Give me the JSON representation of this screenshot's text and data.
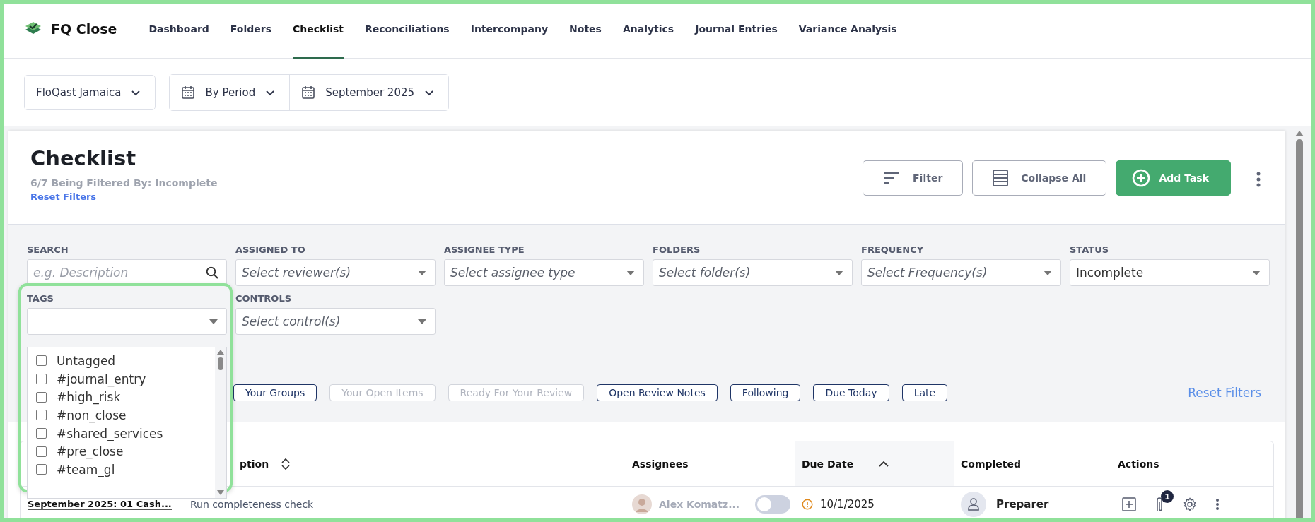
{
  "app": {
    "name": "FQ Close"
  },
  "nav": [
    {
      "label": "Dashboard",
      "selected": false
    },
    {
      "label": "Folders",
      "selected": false
    },
    {
      "label": "Checklist",
      "selected": true
    },
    {
      "label": "Reconciliations",
      "selected": false
    },
    {
      "label": "Intercompany",
      "selected": false
    },
    {
      "label": "Notes",
      "selected": false
    },
    {
      "label": "Analytics",
      "selected": false
    },
    {
      "label": "Journal Entries",
      "selected": false
    },
    {
      "label": "Variance Analysis",
      "selected": false
    }
  ],
  "toolbar": {
    "entity": "FloQast Jamaica",
    "view": "By Period",
    "period": "September 2025"
  },
  "checklist": {
    "title": "Checklist",
    "filter_summary": "6/7 Being Filtered By: Incomplete",
    "reset_link": "Reset Filters",
    "buttons": [
      {
        "kind": "filter",
        "label": "Filter"
      },
      {
        "kind": "collapse",
        "label": "Collapse All"
      },
      {
        "kind": "add",
        "label": "Add Task"
      }
    ]
  },
  "filters": [
    {
      "kind": "search",
      "label": "SEARCH",
      "placeholder": "e.g. Description"
    },
    {
      "kind": "select",
      "label": "ASSIGNED TO",
      "placeholder": "Select reviewer(s)"
    },
    {
      "kind": "select",
      "label": "ASSIGNEE TYPE",
      "placeholder": "Select assignee type"
    },
    {
      "kind": "select",
      "label": "FOLDERS",
      "placeholder": "Select folder(s)"
    },
    {
      "kind": "select",
      "label": "FREQUENCY",
      "placeholder": "Select Frequency(s)"
    },
    {
      "kind": "select",
      "label": "STATUS",
      "value": "Incomplete"
    },
    {
      "kind": "tags",
      "label": "TAGS"
    },
    {
      "kind": "select",
      "label": "CONTROLS",
      "placeholder": "Select control(s)"
    }
  ],
  "tag_options": [
    {
      "label": "Untagged",
      "checked": false
    },
    {
      "label": "#journal_entry",
      "checked": false
    },
    {
      "label": "#high_risk",
      "checked": false
    },
    {
      "label": "#non_close",
      "checked": false
    },
    {
      "label": "#shared_services",
      "checked": false
    },
    {
      "label": "#pre_close",
      "checked": false
    },
    {
      "label": "#team_gl",
      "checked": false
    }
  ],
  "quick_filters": [
    {
      "label": "Your Groups",
      "disabled": false
    },
    {
      "label": "Your Open Items",
      "disabled": true
    },
    {
      "label": "Ready For Your Review",
      "disabled": true
    },
    {
      "label": "Open Review Notes",
      "disabled": false
    },
    {
      "label": "Following",
      "disabled": false
    },
    {
      "label": "Due Today",
      "disabled": false
    },
    {
      "label": "Late",
      "disabled": false
    }
  ],
  "reset_filters": "Reset Filters",
  "table": {
    "columns": [
      {
        "label": "ption",
        "sortable": true,
        "sorted_ascending": false
      },
      {
        "label": "Assignees",
        "sortable": false,
        "sorted_ascending": false
      },
      {
        "label": "Due Date",
        "sortable": false,
        "sorted_ascending": true
      },
      {
        "label": "Completed",
        "sortable": false,
        "sorted_ascending": false
      },
      {
        "label": "Actions",
        "sortable": false,
        "sorted_ascending": false
      }
    ],
    "rows": [
      {
        "task": "September 2025: 01 Cash...",
        "description": "Run completeness check",
        "assignee": "Alex Komatz...",
        "toggle_on": false,
        "due_date": "10/1/2025",
        "role": "Preparer",
        "attachment_count": "1"
      }
    ]
  }
}
